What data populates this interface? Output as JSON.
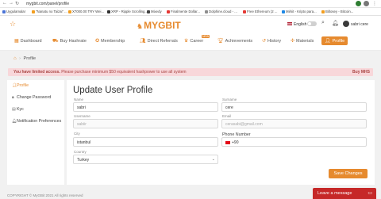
{
  "browser": {
    "url": "mygbit.com/panel/profile",
    "bookmarks": [
      "Uygulamalar",
      "\"Nanatu no Taizai\" ...",
      "X7000.00 TRY Wei...",
      "XRP - Ripple Scrolling...",
      "Mixedy",
      "Finalmente Dollar...",
      "Dolphine.cloud - ...",
      "Free Ethereum (2 ...",
      "Mirkit - Kripto para...",
      "Bitlosey - Bitcoin..."
    ]
  },
  "header": {
    "logo": "MYGBIT",
    "language": "English",
    "user_name": "sabri cere"
  },
  "nav": {
    "items": [
      {
        "label": "Dashboard",
        "icon": "grid-icon"
      },
      {
        "label": "Buy Hashrate",
        "icon": "cart-icon"
      },
      {
        "label": "Membership",
        "icon": "badge-icon"
      },
      {
        "label": "Direct Referrals",
        "icon": "users-icon"
      },
      {
        "label": "Career",
        "icon": "career-icon",
        "badge": "NEW"
      },
      {
        "label": "Achievements",
        "icon": "trophy-icon"
      },
      {
        "label": "History",
        "icon": "history-icon"
      },
      {
        "label": "Materials",
        "icon": "materials-icon"
      },
      {
        "label": "Profile",
        "icon": "user-icon"
      }
    ]
  },
  "breadcrumb": {
    "home_icon": "home-icon",
    "current": "Profile"
  },
  "alert": {
    "bold": "You have limited access.",
    "text": "Please purchase minimum $50 equivalent hashpower to use all system",
    "link": "Buy MHS"
  },
  "sidebar": {
    "items": [
      {
        "label": "Profile",
        "icon": "user-icon"
      },
      {
        "label": "Change Password",
        "icon": "lock-icon"
      },
      {
        "label": "Kyc",
        "icon": "id-icon"
      },
      {
        "label": "Notification Preferences",
        "icon": "bell-icon"
      }
    ]
  },
  "form": {
    "title": "Update User Profile",
    "first_name": {
      "label": "Name",
      "value": "sabri"
    },
    "last_name": {
      "label": "Surname",
      "value": "cere"
    },
    "username": {
      "label": "Username",
      "value": "sabiir"
    },
    "email": {
      "label": "Email",
      "value": "cerasabi@gmail.com"
    },
    "city": {
      "label": "City",
      "value": "istanbul"
    },
    "phone": {
      "label": "Phone Number",
      "value": "+90"
    },
    "country": {
      "label": "Country",
      "value": "Turkey"
    },
    "save_label": "Save Changes"
  },
  "footer": {
    "copyright": "COPYRIGHT © MyGBit 2021 All rights reserved",
    "chat": "Leave a message"
  },
  "colors": {
    "accent": "#e68a2e",
    "alert_bg": "#f8d7da",
    "alert_text": "#a94442",
    "chat": "#c62828"
  }
}
